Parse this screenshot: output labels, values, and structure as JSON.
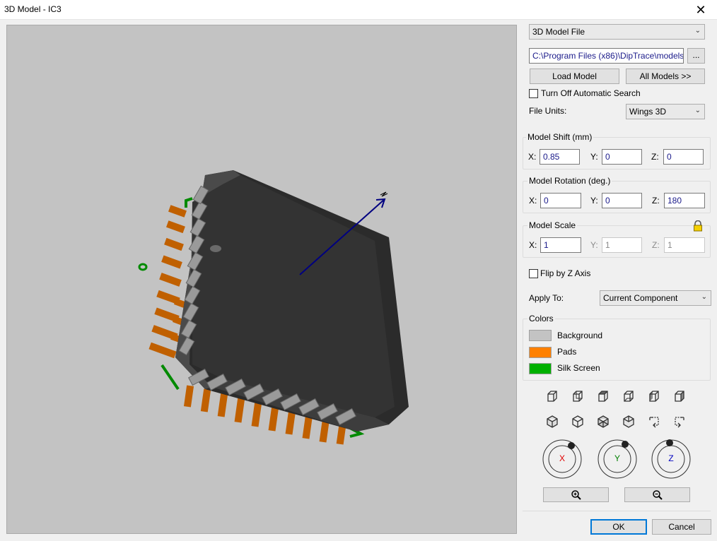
{
  "window": {
    "title": "3D Model - IC3",
    "close_glyph": "✕"
  },
  "model_source": {
    "selected": "3D Model File",
    "path": "C:\\Program Files (x86)\\DipTrace\\models",
    "browse_label": "...",
    "load_label": "Load Model",
    "all_models_label": "All Models >>",
    "auto_search_label": "Turn Off Automatic Search",
    "auto_search_checked": false,
    "file_units_label": "File Units:",
    "file_units_value": "Wings 3D"
  },
  "model_shift": {
    "title": "Model Shift (mm)",
    "x_label": "X:",
    "x": "0.85",
    "y_label": "Y:",
    "y": "0",
    "z_label": "Z:",
    "z": "0"
  },
  "model_rotation": {
    "title": "Model Rotation (deg.)",
    "x_label": "X:",
    "x": "0",
    "y_label": "Y:",
    "y": "0",
    "z_label": "Z:",
    "z": "180"
  },
  "model_scale": {
    "title": "Model Scale",
    "x_label": "X:",
    "x": "1",
    "y_label": "Y:",
    "y": "1",
    "z_label": "Z:",
    "z": "1",
    "lock_icon": "lock-icon"
  },
  "flip_z": {
    "label": "Flip by Z Axis",
    "checked": false
  },
  "apply_to": {
    "label": "Apply To:",
    "value": "Current Component"
  },
  "colors": {
    "title": "Colors",
    "items": [
      {
        "label": "Background",
        "color": "#c3c3c3"
      },
      {
        "label": "Pads",
        "color": "#ff8000"
      },
      {
        "label": "Silk Screen",
        "color": "#00b000"
      }
    ]
  },
  "rotation_dials": [
    {
      "label": "X",
      "color": "#e00000"
    },
    {
      "label": "Y",
      "color": "#008000"
    },
    {
      "label": "Z",
      "color": "#0000c0"
    }
  ],
  "zoom": {
    "zoom_in_icon": "zoom-in-icon",
    "zoom_out_icon": "zoom-out-icon"
  },
  "footer": {
    "ok_label": "OK",
    "cancel_label": "Cancel"
  }
}
